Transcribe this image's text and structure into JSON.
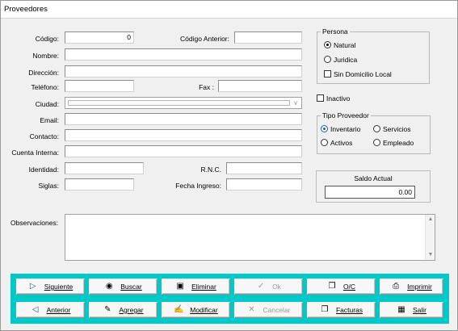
{
  "window": {
    "title": "Proveedores"
  },
  "labels": {
    "codigo": "Código:",
    "codigo_anterior": "Código Anterior:",
    "nombre": "Nombre:",
    "direccion": "Dirección:",
    "telefono": "Teléfono:",
    "fax": "Fax :",
    "ciudad": "Ciudad:",
    "email": "Email:",
    "contacto": "Contacto:",
    "cuenta_interna": "Cuenta Interna:",
    "identidad": "Identidad:",
    "rnc": "R.N.C.",
    "siglas": "Siglas:",
    "fecha_ingreso": "Fecha Ingreso:",
    "observaciones": "Observaciones:"
  },
  "fields": {
    "codigo": "0",
    "codigo_anterior": "",
    "nombre": "",
    "direccion": "",
    "telefono": "",
    "fax": "",
    "ciudad": "",
    "email": "",
    "contacto": "",
    "cuenta_interna": "",
    "identidad": "",
    "rnc": "",
    "siglas": "",
    "fecha_ingreso": "",
    "observaciones": ""
  },
  "persona": {
    "caption": "Persona",
    "natural": "Natural",
    "juridica": "Juridica",
    "sin_domicilio": "Sin Domicilio Local",
    "selected": "natural",
    "sin_domicilio_checked": false
  },
  "inactivo": {
    "label": "Inactivo",
    "checked": false
  },
  "tipo_proveedor": {
    "caption": "Tipo Proveedor",
    "inventario": "Inventario",
    "servicios": "Servicios",
    "activos": "Activos",
    "empleado": "Empleado",
    "selected": "inventario"
  },
  "saldo": {
    "caption": "Saldo Actual",
    "value": "0.00"
  },
  "buttons": {
    "siguiente": "Siguiente",
    "buscar": "Buscar",
    "eliminar": "Eliminar",
    "ok": "Ok",
    "oc": "O/C",
    "imprimir": "Imprimir",
    "anterior": "Anterior",
    "agregar": "Agregar",
    "modificar": "Modificar",
    "cancelar": "Cancelar",
    "facturas": "Facturas",
    "salir": "Salir"
  },
  "icons": {
    "siguiente": "play-right-icon",
    "buscar": "binoculars-icon",
    "eliminar": "trash-icon",
    "ok": "checkmark-icon",
    "oc": "documents-icon",
    "imprimir": "printer-icon",
    "anterior": "play-left-icon",
    "agregar": "pencil-icon",
    "modificar": "hand-edit-icon",
    "cancelar": "x-cancel-icon",
    "facturas": "invoices-icon",
    "salir": "exit-door-icon"
  },
  "colors": {
    "button_bar": "#00c9c9",
    "window_bg": "#f0f0f0",
    "icon_blue": "#1a4fa0"
  }
}
